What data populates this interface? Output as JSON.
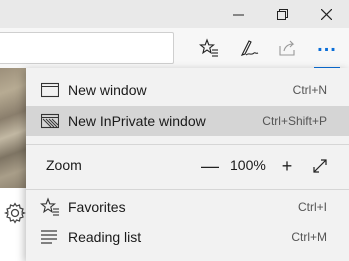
{
  "window_controls": {
    "minimize": "—",
    "restore": "⧉",
    "close": "✕"
  },
  "toolbar": {
    "icons": [
      "add-favorite-star-icon",
      "pen-sign-icon",
      "share-icon",
      "more-dots-icon"
    ],
    "more_label": "..."
  },
  "menu": {
    "items": [
      {
        "label": "New window",
        "shortcut": "Ctrl+N",
        "icon": "window-icon"
      },
      {
        "label": "New InPrivate window",
        "shortcut": "Ctrl+Shift+P",
        "icon": "inprivate-icon"
      },
      {
        "label": "Favorites",
        "shortcut": "Ctrl+I",
        "icon": "favorites-star-icon"
      },
      {
        "label": "Reading list",
        "shortcut": "Ctrl+M",
        "icon": "reading-list-icon"
      }
    ],
    "zoom": {
      "label": "Zoom",
      "value": "100%",
      "decrease": "—",
      "increase": "+"
    }
  },
  "colors": {
    "accent": "#0a6ed8",
    "menu_bg": "#f2f2f2",
    "highlight": "#d5d5d5"
  }
}
